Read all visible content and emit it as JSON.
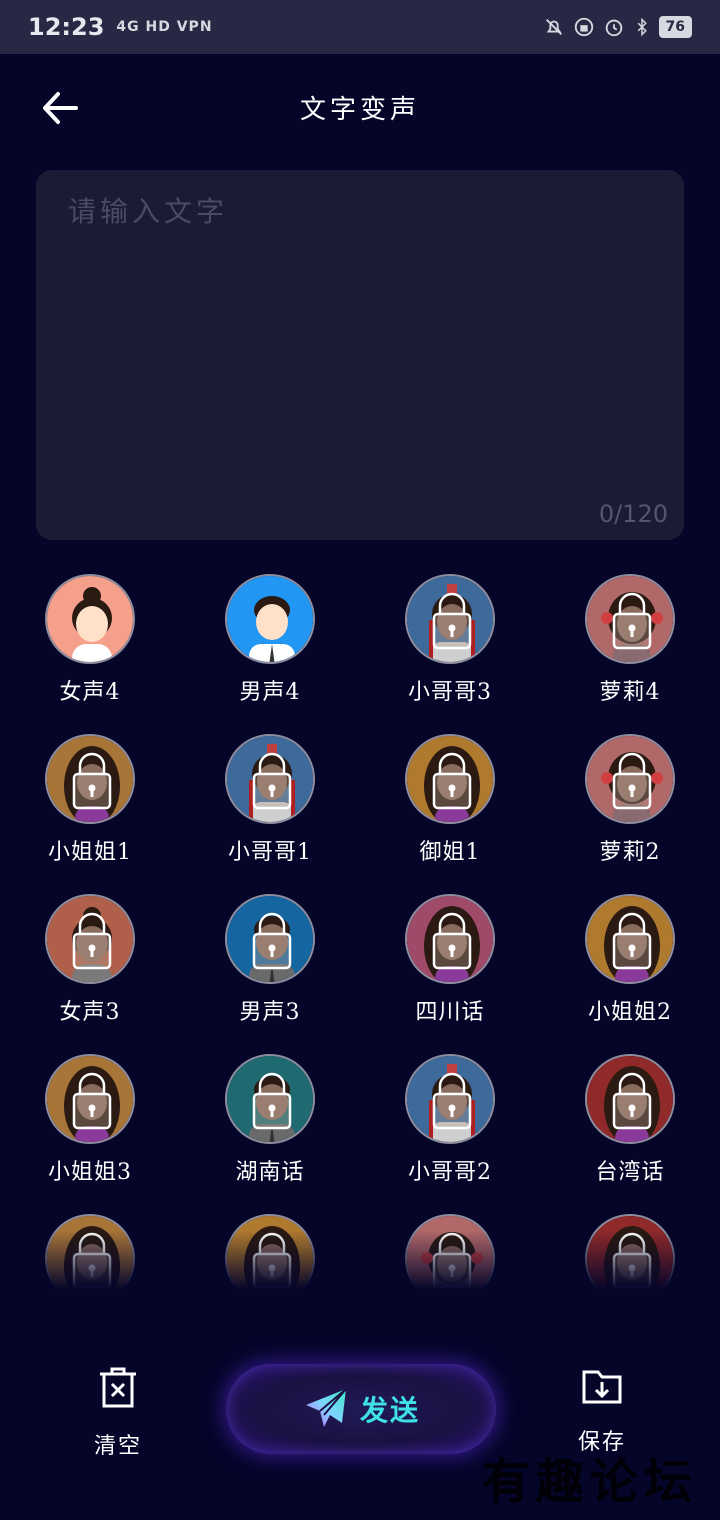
{
  "status_bar": {
    "time": "12:23",
    "left_indicators": "4G HD VPN",
    "battery": "76",
    "right_icons": [
      "mute-bell-icon",
      "lock-rotation-icon",
      "alarm-icon",
      "bluetooth-icon"
    ]
  },
  "header": {
    "title": "文字变声",
    "back_icon": "arrow-left-icon"
  },
  "text_input": {
    "placeholder": "请输入文字",
    "value": "",
    "char_count": "0/120"
  },
  "voices": [
    {
      "label": "女声4",
      "avatar": "woman-bun",
      "locked": false,
      "bg": "#f4a08a"
    },
    {
      "label": "男声4",
      "avatar": "man-suit",
      "locked": false,
      "bg": "#2196f3"
    },
    {
      "label": "小哥哥3",
      "avatar": "ancient-man",
      "locked": true,
      "bg": "#3d6a9a"
    },
    {
      "label": "萝莉4",
      "avatar": "girl-flowers",
      "locked": true,
      "bg": "#b06868"
    },
    {
      "label": "小姐姐1",
      "avatar": "long-hair-woman",
      "locked": true,
      "bg": "#a87538"
    },
    {
      "label": "小哥哥1",
      "avatar": "ancient-man",
      "locked": true,
      "bg": "#3d6a9a"
    },
    {
      "label": "御姐1",
      "avatar": "long-hair-woman",
      "locked": true,
      "bg": "#b07a2e"
    },
    {
      "label": "萝莉2",
      "avatar": "girl-flowers",
      "locked": true,
      "bg": "#b06868"
    },
    {
      "label": "女声3",
      "avatar": "woman-bun",
      "locked": true,
      "bg": "#b0604a"
    },
    {
      "label": "男声3",
      "avatar": "man-suit",
      "locked": true,
      "bg": "#1565a0"
    },
    {
      "label": "四川话",
      "avatar": "long-hair-woman",
      "locked": true,
      "bg": "#a04a6a"
    },
    {
      "label": "小姐姐2",
      "avatar": "long-hair-woman",
      "locked": true,
      "bg": "#b07a2e"
    },
    {
      "label": "小姐姐3",
      "avatar": "long-hair-woman",
      "locked": true,
      "bg": "#a87538"
    },
    {
      "label": "湖南话",
      "avatar": "man-suit",
      "locked": true,
      "bg": "#1e6a70"
    },
    {
      "label": "小哥哥2",
      "avatar": "ancient-man",
      "locked": true,
      "bg": "#3d6a9a"
    },
    {
      "label": "台湾话",
      "avatar": "long-hair-woman",
      "locked": true,
      "bg": "#902a2a"
    },
    {
      "label": "",
      "avatar": "long-hair-woman",
      "locked": true,
      "bg": "#a87538"
    },
    {
      "label": "",
      "avatar": "long-hair-woman",
      "locked": true,
      "bg": "#b07a2e"
    },
    {
      "label": "",
      "avatar": "girl-flowers",
      "locked": true,
      "bg": "#b06868"
    },
    {
      "label": "",
      "avatar": "long-hair-woman",
      "locked": true,
      "bg": "#902a2a"
    }
  ],
  "actions": {
    "clear_label": "清空",
    "clear_icon": "trash-x-icon",
    "send_label": "发送",
    "send_icon": "paper-plane-icon",
    "save_label": "保存",
    "save_icon": "folder-download-icon"
  },
  "watermark": "有趣论坛",
  "colors": {
    "background": "#05052a",
    "status_bar": "#282844",
    "input_bg": "#1b1b36",
    "send_text": "#3fe0e8",
    "send_glow": "#5228c8"
  }
}
